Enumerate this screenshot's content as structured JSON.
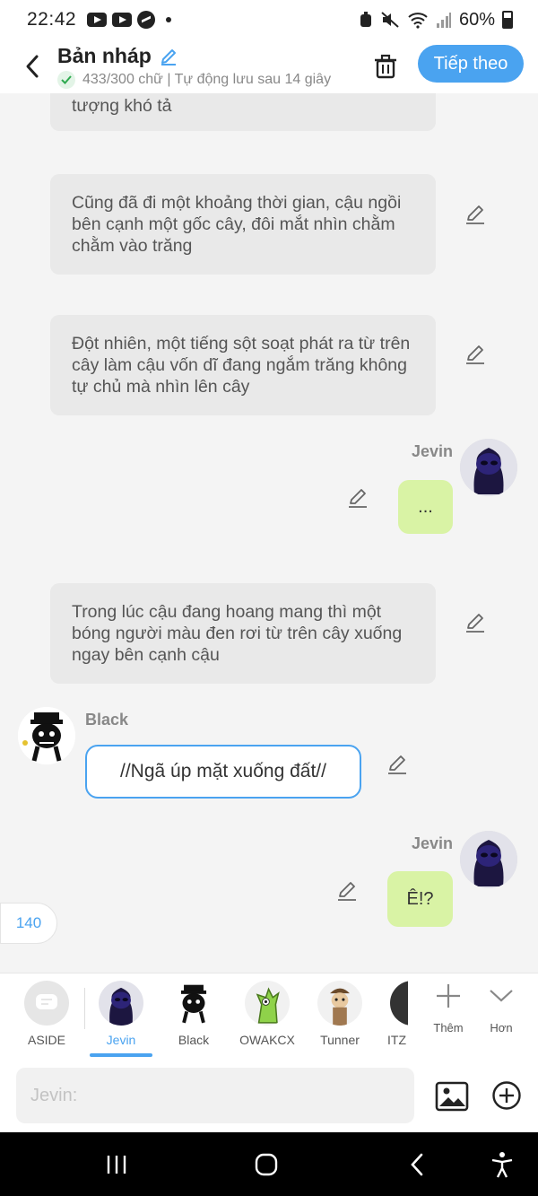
{
  "status_bar": {
    "time": "22:42",
    "battery": "60%"
  },
  "header": {
    "title": "Bản nháp",
    "subtitle": "433/300 chữ | Tự động lưu sau 14 giây",
    "next_label": "Tiếp theo"
  },
  "messages": {
    "narration_top_fragment": "tượng khó tả",
    "narration_1": "Cũng đã đi một khoảng thời gian, cậu ngồi bên cạnh một gốc cây, đôi mắt nhìn chằm chằm vào trăng",
    "narration_2": "Đột nhiên, một tiếng sột soạt phát ra từ trên cây làm cậu vốn dĩ đang ngắm trăng không tự chủ mà nhìn lên cây",
    "jevin_name_1": "Jevin",
    "jevin_msg_1": "...",
    "narration_3": "Trong lúc cậu đang hoang mang thì một bóng người màu đen rơi từ trên cây xuống ngay bên cạnh cậu",
    "black_name": "Black",
    "black_msg": "//Ngã úp mặt xuống đất//",
    "jevin_name_2": "Jevin",
    "jevin_msg_2": "Ê!?"
  },
  "counter": "140",
  "characters": [
    {
      "label": "ASIDE",
      "icon": "chat-bubble-icon"
    },
    {
      "label": "Jevin",
      "active": true
    },
    {
      "label": "Black"
    },
    {
      "label": "OWAKCX"
    },
    {
      "label": "Tunner"
    },
    {
      "label": "ITZ"
    }
  ],
  "tools": {
    "add_label": "Thêm",
    "more_label": "Hơn"
  },
  "composer": {
    "placeholder": "Jevin:"
  },
  "colors": {
    "accent": "#4aa3f0",
    "green_bubble": "#d9f3a5",
    "narration_bg": "#e9e9e9"
  }
}
